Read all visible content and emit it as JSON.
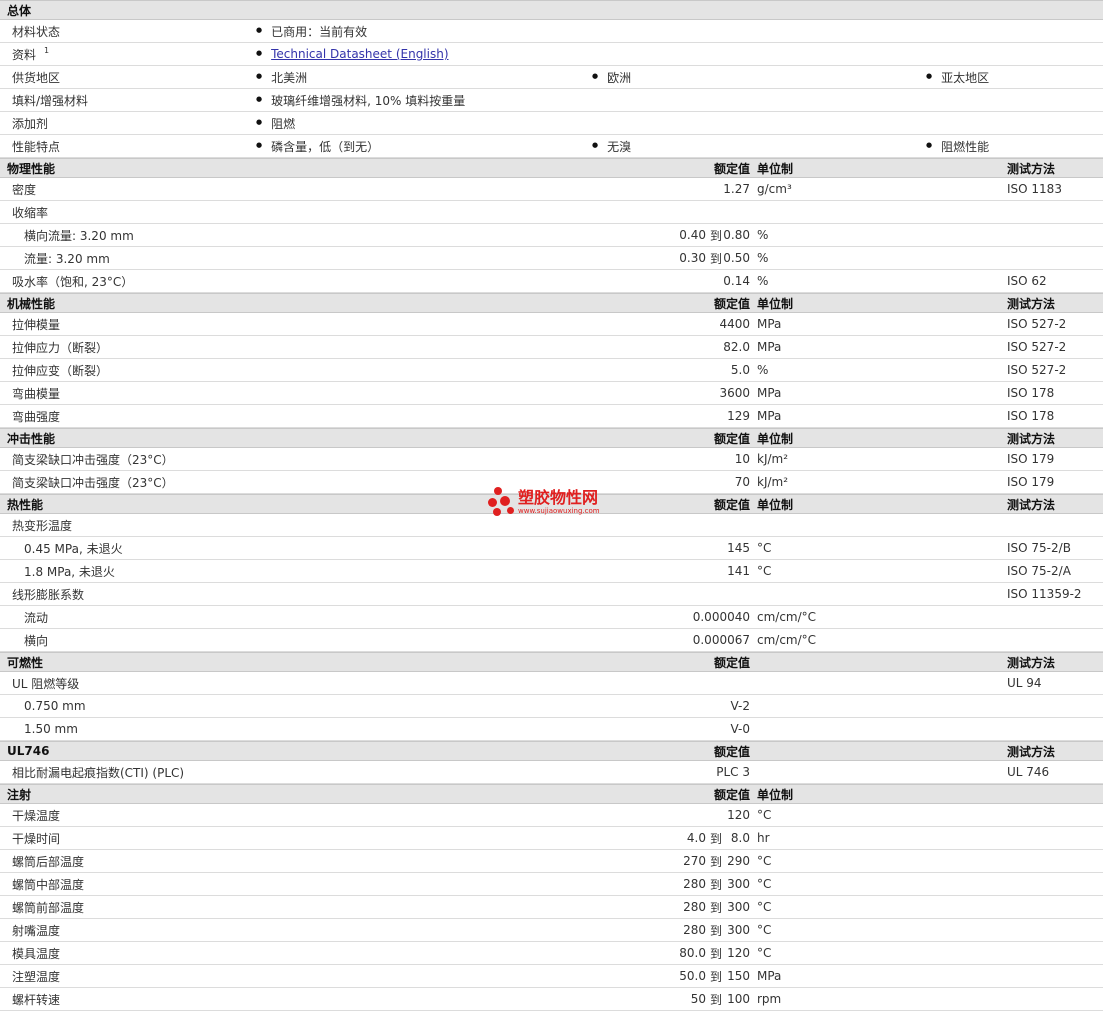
{
  "general": {
    "title": "总体",
    "rows": [
      {
        "label": "材料状态",
        "values": [
          "已商用：当前有效"
        ]
      },
      {
        "label": "资料",
        "sup": "1",
        "link": "Technical Datasheet (English)"
      },
      {
        "label": "供货地区",
        "values": [
          "北美洲",
          "欧洲",
          "亚太地区"
        ]
      },
      {
        "label": "填料/增强材料",
        "values": [
          "玻璃纤维增强材料, 10% 填料按重量"
        ]
      },
      {
        "label": "添加剂",
        "values": [
          "阻燃"
        ]
      },
      {
        "label": "性能特点",
        "values": [
          "磷含量，低（到无）",
          "无溴",
          "阻燃性能"
        ]
      }
    ]
  },
  "headers": {
    "nominal": "额定值",
    "unit": "单位制",
    "method": "测试方法"
  },
  "sections": [
    {
      "title": "物理性能",
      "show_unit": true,
      "show_method": true,
      "rows": [
        {
          "label": "密度",
          "value": "1.27",
          "unit": "g/cm³",
          "method": "ISO 1183"
        },
        {
          "label": "收缩率"
        },
        {
          "label": "横向流量: 3.20 mm",
          "indent": true,
          "v1": "0.40",
          "to": "到",
          "v2": "0.80",
          "unit": "%"
        },
        {
          "label": "流量: 3.20 mm",
          "indent": true,
          "v1": "0.30",
          "to": "到",
          "v2": "0.50",
          "unit": "%"
        },
        {
          "label": "吸水率（饱和, 23°C）",
          "value": "0.14",
          "unit": "%",
          "method": "ISO 62"
        }
      ]
    },
    {
      "title": "机械性能",
      "show_unit": true,
      "show_method": true,
      "rows": [
        {
          "label": "拉伸模量",
          "value": "4400",
          "unit": "MPa",
          "method": "ISO 527-2"
        },
        {
          "label": "拉伸应力（断裂）",
          "value": "82.0",
          "unit": "MPa",
          "method": "ISO 527-2"
        },
        {
          "label": "拉伸应变（断裂）",
          "value": "5.0",
          "unit": "%",
          "method": "ISO 527-2"
        },
        {
          "label": "弯曲模量",
          "value": "3600",
          "unit": "MPa",
          "method": "ISO 178"
        },
        {
          "label": "弯曲强度",
          "value": "129",
          "unit": "MPa",
          "method": "ISO 178"
        }
      ]
    },
    {
      "title": "冲击性能",
      "show_unit": true,
      "show_method": true,
      "rows": [
        {
          "label": "简支梁缺口冲击强度（23°C）",
          "value": "10",
          "unit": "kJ/m²",
          "method": "ISO 179"
        },
        {
          "label": "简支梁缺口冲击强度（23°C）",
          "value": "70",
          "unit": "kJ/m²",
          "method": "ISO 179"
        }
      ]
    },
    {
      "title": "热性能",
      "show_unit": true,
      "show_method": true,
      "rows": [
        {
          "label": "热变形温度"
        },
        {
          "label": "0.45 MPa, 未退火",
          "indent": true,
          "value": "145",
          "unit": "°C",
          "method": "ISO 75-2/B"
        },
        {
          "label": "1.8 MPa, 未退火",
          "indent": true,
          "value": "141",
          "unit": "°C",
          "method": "ISO 75-2/A"
        },
        {
          "label": "线形膨胀系数",
          "method": "ISO 11359-2"
        },
        {
          "label": "流动",
          "indent": true,
          "value": "0.000040",
          "unit": "cm/cm/°C"
        },
        {
          "label": "横向",
          "indent": true,
          "value": "0.000067",
          "unit": "cm/cm/°C"
        }
      ]
    },
    {
      "title": "可燃性",
      "show_unit": false,
      "show_method": true,
      "rows": [
        {
          "label": "UL 阻燃等级",
          "method": "UL 94"
        },
        {
          "label": "0.750 mm",
          "indent": true,
          "value": "V-2"
        },
        {
          "label": "1.50 mm",
          "indent": true,
          "value": "V-0"
        }
      ]
    },
    {
      "title": "UL746",
      "show_unit": false,
      "show_method": true,
      "rows": [
        {
          "label": "相比耐漏电起痕指数(CTI) (PLC)",
          "value": "PLC 3",
          "method": "UL 746"
        }
      ]
    },
    {
      "title": "注射",
      "show_unit": true,
      "show_method": false,
      "rows": [
        {
          "label": "干燥温度",
          "value": "120",
          "unit": "°C"
        },
        {
          "label": "干燥时间",
          "v1": "4.0",
          "to": "到",
          "v2": "8.0",
          "unit": "hr"
        },
        {
          "label": "螺筒后部温度",
          "v1": "270",
          "to": "到",
          "v2": "290",
          "unit": "°C"
        },
        {
          "label": "螺筒中部温度",
          "v1": "280",
          "to": "到",
          "v2": "300",
          "unit": "°C"
        },
        {
          "label": "螺筒前部温度",
          "v1": "280",
          "to": "到",
          "v2": "300",
          "unit": "°C"
        },
        {
          "label": "射嘴温度",
          "v1": "280",
          "to": "到",
          "v2": "300",
          "unit": "°C"
        },
        {
          "label": "模具温度",
          "v1": "80.0",
          "to": "到",
          "v2": "120",
          "unit": "°C"
        },
        {
          "label": "注塑温度",
          "v1": "50.0",
          "to": "到",
          "v2": "150",
          "unit": "MPa"
        },
        {
          "label": "螺杆转速",
          "v1": "50",
          "to": "到",
          "v2": "100",
          "unit": "rpm"
        }
      ]
    }
  ],
  "watermark": {
    "name": "塑胶物性网",
    "url": "www.sujiaowuxing.com",
    "color": "#e02020"
  }
}
